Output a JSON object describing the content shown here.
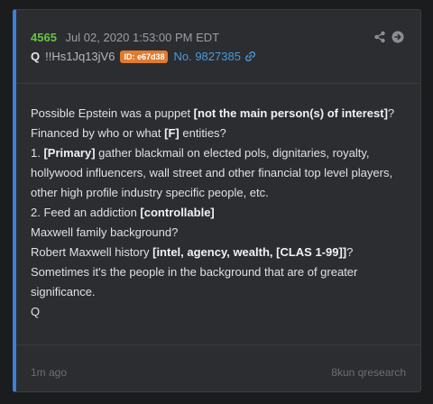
{
  "post": {
    "number": "4565",
    "datetime": "Jul 02, 2020 1:53:00 PM EDT",
    "author": "Q",
    "tripcode": "!!Hs1Jq13jV6",
    "id_badge": "ID: e67d38",
    "post_link": "No. 9827385",
    "colors": {
      "accent": "#3d7fd6",
      "post_number": "#6ac341",
      "id_badge": "#e07b2e",
      "link": "#4a9ade"
    },
    "icons": [
      "share-icon",
      "arrow-right-circle-icon",
      "link-icon"
    ]
  },
  "body": {
    "l1_a": "Possible Epstein was a puppet ",
    "l1_b": "[not the main person(s) of interest]",
    "l1_c": "?",
    "l2_a": "Financed by who or what ",
    "l2_b": "[F]",
    "l2_c": " entities?",
    "l3_a": "1. ",
    "l3_b": "[Primary]",
    "l3_c": " gather blackmail on elected pols, dignitaries, royalty, hollywood influencers, wall street and other financial top level players, other high profile industry specific people, etc.",
    "l4_a": "2. Feed an addiction ",
    "l4_b": "[controllable]",
    "l5": "Maxwell family background?",
    "l6_a": "Robert Maxwell history ",
    "l6_b": "[intel, agency, wealth, [CLAS 1-99]]",
    "l6_c": "?",
    "l7": "Sometimes it's the people in the background that are of greater significance.",
    "l8": "Q"
  },
  "footer": {
    "time_ago": "1m ago",
    "source": "8kun qresearch"
  }
}
